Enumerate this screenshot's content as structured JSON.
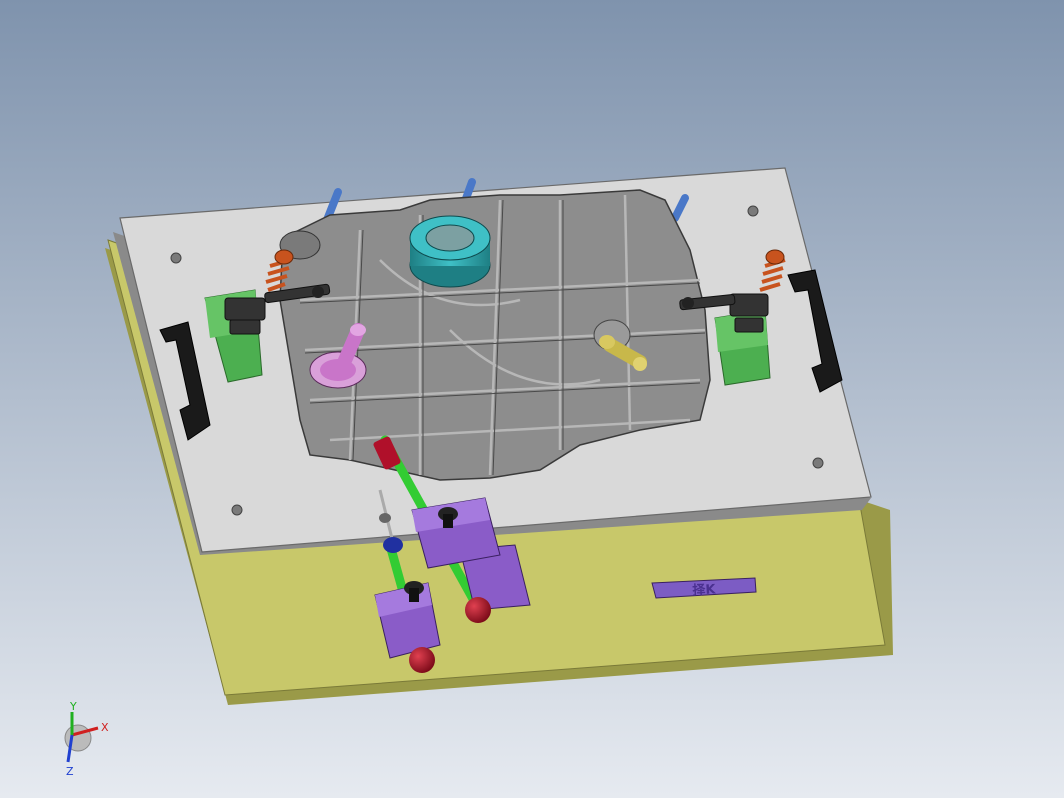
{
  "viewport": {
    "background_top": "#7f93ad",
    "background_bottom": "#e6eaf0"
  },
  "colors": {
    "base_plate": "#c8c86a",
    "base_plate_edge": "#9a9a48",
    "top_plate": "#d9d9d9",
    "top_plate_edge": "#8a8a8a",
    "part_body": "#8d8d8d",
    "part_ridge": "#b7b7b7",
    "clamp_block": "#4caf50",
    "clamp_arm": "#333333",
    "spring": "#c8531e",
    "handle": "#1a1a1a",
    "teal_fitting": "#2fa3a8",
    "pink_pin": "#c975c9",
    "gold_pin": "#c8b84a",
    "blue_pin": "#4a78c8",
    "rod": "#33cc33",
    "rod_block": "#8a5cc8",
    "knob": "#b0102a",
    "label_plate": "#7c5cc4"
  },
  "label_plate": {
    "text": "择K"
  },
  "triad": {
    "x_label": "X",
    "y_label": "Y",
    "z_label": "Z",
    "x_color": "#d02020",
    "y_color": "#20b020",
    "z_color": "#2040d0"
  }
}
